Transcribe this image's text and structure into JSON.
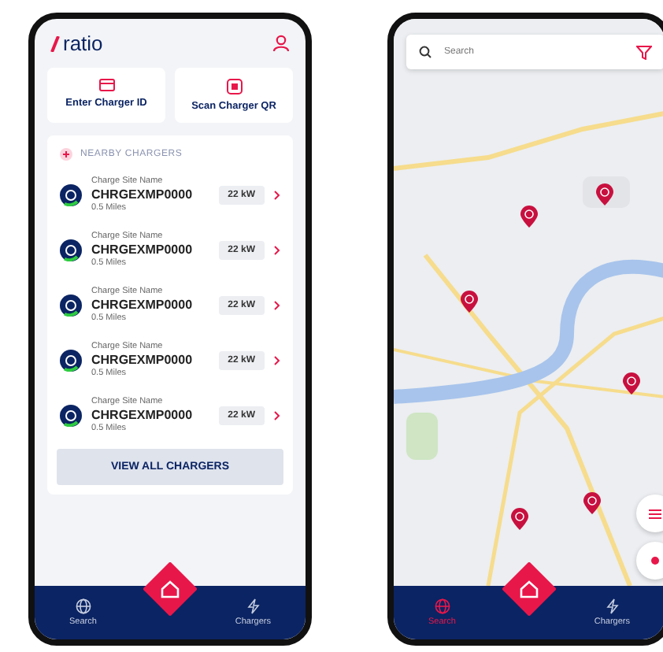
{
  "list_screen": {
    "logo": "ratio",
    "actions": [
      {
        "kind": "id",
        "label": "Enter Charger ID"
      },
      {
        "kind": "qr",
        "label": "Scan Charger QR"
      }
    ],
    "nearby_title": "NEARBY CHARGERS",
    "chargers": [
      {
        "site": "Charge Site Name",
        "code": "CHRGEXMP0000",
        "distance": "0.5 Miles",
        "power": "22 kW"
      },
      {
        "site": "Charge Site Name",
        "code": "CHRGEXMP0000",
        "distance": "0.5 Miles",
        "power": "22 kW"
      },
      {
        "site": "Charge Site Name",
        "code": "CHRGEXMP0000",
        "distance": "0.5 Miles",
        "power": "22 kW"
      },
      {
        "site": "Charge Site Name",
        "code": "CHRGEXMP0000",
        "distance": "0.5 Miles",
        "power": "22 kW"
      },
      {
        "site": "Charge Site Name",
        "code": "CHRGEXMP0000",
        "distance": "0.5 Miles",
        "power": "22 kW"
      }
    ],
    "view_all": "VIEW ALL CHARGERS",
    "nav": [
      {
        "kind": "search",
        "label": "Search",
        "selected": false
      },
      {
        "kind": "chargers",
        "label": "Chargers",
        "selected": false
      }
    ]
  },
  "map_screen": {
    "search": {
      "placeholder": "Search"
    },
    "nav": [
      {
        "kind": "search",
        "label": "Search",
        "selected": true
      },
      {
        "kind": "chargers",
        "label": "Chargers",
        "selected": false
      }
    ]
  }
}
